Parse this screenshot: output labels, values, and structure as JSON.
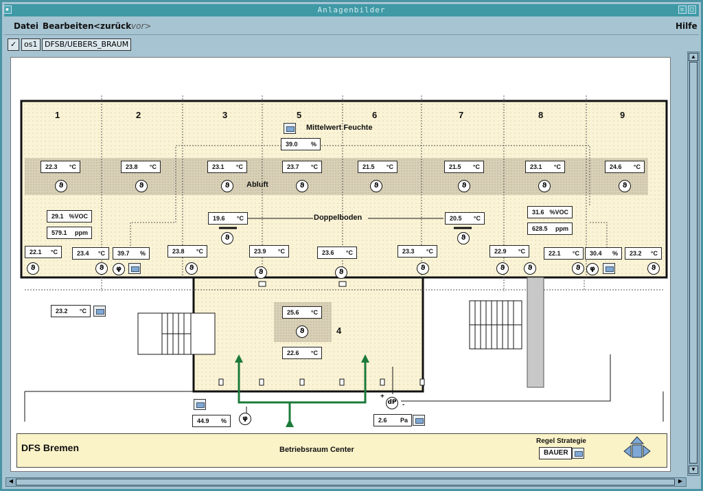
{
  "window": {
    "title": "Anlagenbilder"
  },
  "menu": {
    "file": "Datei",
    "edit": "Bearbeiten",
    "back": "<zurück",
    "forward": "vor>",
    "help": "Hilfe"
  },
  "toolbar": {
    "check": "✓",
    "station": "os1",
    "path": "DFSB/UEBERS_BRAUM"
  },
  "zones": [
    "1",
    "2",
    "3",
    "5",
    "6",
    "7",
    "8",
    "9"
  ],
  "zone4": "4",
  "labels": {
    "mittelwert": "Mittelwert Feuchte",
    "abluft": "Abluft",
    "doppelboden": "Doppelboden"
  },
  "values": {
    "mittelwert": {
      "v": "39.0",
      "u": "%"
    },
    "abluft": [
      {
        "v": "22.3",
        "u": "°C"
      },
      {
        "v": "23.8",
        "u": "°C"
      },
      {
        "v": "23.1",
        "u": "°C"
      },
      {
        "v": "23.7",
        "u": "°C"
      },
      {
        "v": "21.5",
        "u": "°C"
      },
      {
        "v": "21.5",
        "u": "°C"
      },
      {
        "v": "23.1",
        "u": "°C"
      },
      {
        "v": "24.6",
        "u": "°C"
      }
    ],
    "voc1": {
      "v": "29.1",
      "u": "%VOC"
    },
    "ppm1": {
      "v": "579.1",
      "u": "ppm"
    },
    "voc2": {
      "v": "31.6",
      "u": "%VOC"
    },
    "ppm2": {
      "v": "628.5",
      "u": "ppm"
    },
    "db_left": {
      "v": "19.6",
      "u": "°C"
    },
    "db_right": {
      "v": "20.5",
      "u": "°C"
    },
    "row": [
      {
        "v": "22.1",
        "u": "°C"
      },
      {
        "v": "23.4",
        "u": "°C"
      },
      {
        "v": "39.7",
        "u": "%"
      },
      {
        "v": "23.8",
        "u": "°C"
      },
      {
        "v": "23.9",
        "u": "°C"
      },
      {
        "v": "23.6",
        "u": "°C"
      },
      {
        "v": "23.3",
        "u": "°C"
      },
      {
        "v": "22.9",
        "u": "°C"
      },
      {
        "v": "22.1",
        "u": "°C"
      },
      {
        "v": "30.4",
        "u": "%"
      },
      {
        "v": "23.2",
        "u": "°C"
      }
    ],
    "out_left": {
      "v": "23.2",
      "u": "°C"
    },
    "z4_top": {
      "v": "25.6",
      "u": "°C"
    },
    "z4_bot": {
      "v": "22.6",
      "u": "°C"
    },
    "hum": {
      "v": "44.9",
      "u": "%"
    },
    "dp": {
      "v": "2.6",
      "u": "Pa"
    },
    "dp_label": "dP",
    "plus": "+",
    "minus": "-"
  },
  "sensor_glyph": "ϑ",
  "phi_glyph": "φ",
  "footer": {
    "site": "DFS Bremen",
    "room": "Betriebsraum Center",
    "strategy_label": "Regel Strategie",
    "strategy_value": "BAUER"
  },
  "colors": {
    "room_fill": "#faf3d6",
    "band": "#d8d0b8",
    "pipe": "#1c7a3a",
    "titlebar": "#3f9aa6",
    "footer_bg": "#fbf3c8",
    "nav": "#7fa8d6"
  }
}
